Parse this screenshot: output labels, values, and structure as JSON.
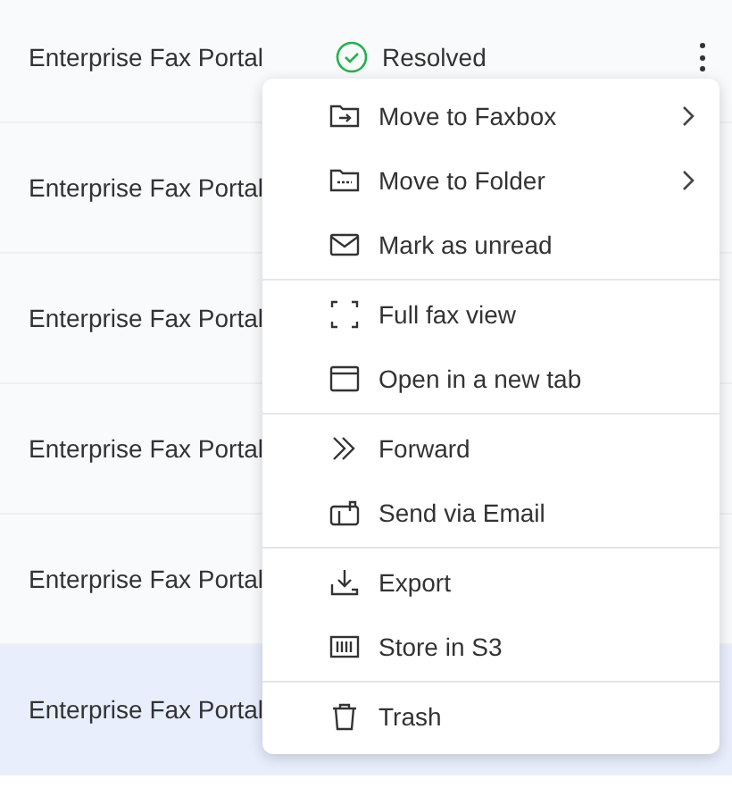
{
  "rows": [
    {
      "name": "Enterprise Fax Portal",
      "status": "Resolved",
      "selected": false
    },
    {
      "name": "Enterprise Fax Portal",
      "selected": false
    },
    {
      "name": "Enterprise Fax Portal",
      "selected": false
    },
    {
      "name": "Enterprise Fax Portal",
      "selected": false
    },
    {
      "name": "Enterprise Fax Portal",
      "selected": false
    },
    {
      "name": "Enterprise Fax Portal",
      "selected": true
    }
  ],
  "menu": {
    "groups": [
      [
        {
          "label": "Move to Faxbox",
          "submenu": true
        },
        {
          "label": "Move to Folder",
          "submenu": true
        },
        {
          "label": "Mark as unread",
          "submenu": false
        }
      ],
      [
        {
          "label": "Full fax view",
          "submenu": false
        },
        {
          "label": "Open in a new tab",
          "submenu": false
        }
      ],
      [
        {
          "label": "Forward",
          "submenu": false
        },
        {
          "label": "Send via Email",
          "submenu": false
        }
      ],
      [
        {
          "label": "Export",
          "submenu": false
        },
        {
          "label": "Store in S3",
          "submenu": false
        }
      ],
      [
        {
          "label": "Trash",
          "submenu": false
        }
      ]
    ]
  }
}
